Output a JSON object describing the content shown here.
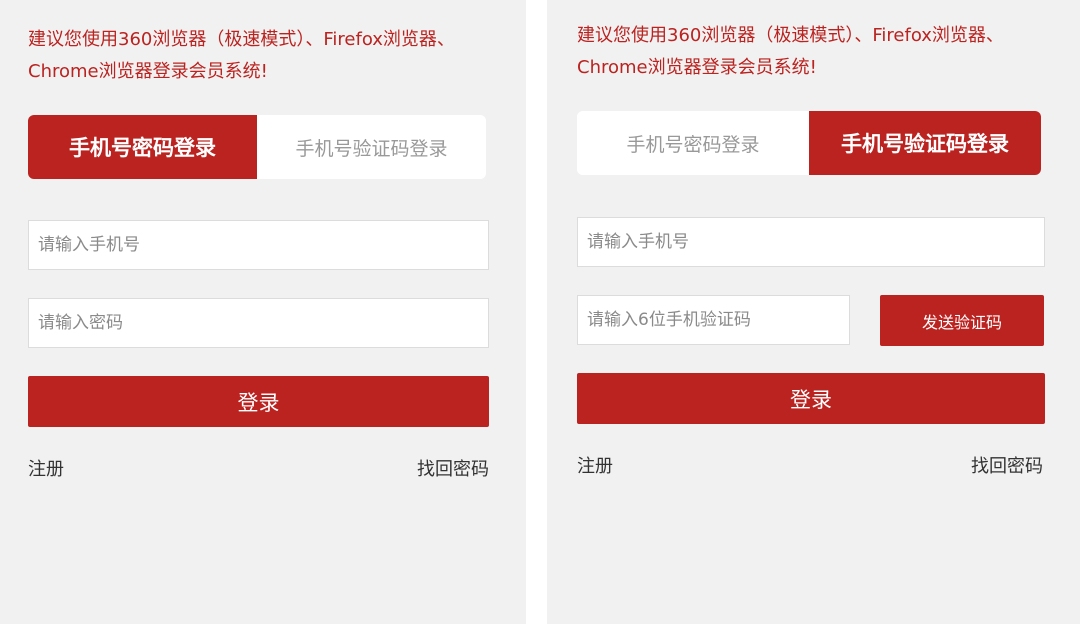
{
  "colors": {
    "brand_red": "#bb2320",
    "panel_bg": "#f1f1f1",
    "inactive_tab_text": "#999999"
  },
  "left_panel": {
    "notice": "建议您使用360浏览器（极速模式）、Firefox浏览器、Chrome浏览器登录会员系统!",
    "tabs": [
      {
        "label": "手机号密码登录",
        "active": true
      },
      {
        "label": "手机号验证码登录",
        "active": false
      }
    ],
    "phone_placeholder": "请输入手机号",
    "password_placeholder": "请输入密码",
    "login_label": "登录",
    "register_label": "注册",
    "forgot_label": "找回密码"
  },
  "right_panel": {
    "notice": "建议您使用360浏览器（极速模式）、Firefox浏览器、Chrome浏览器登录会员系统!",
    "tabs": [
      {
        "label": "手机号密码登录",
        "active": false
      },
      {
        "label": "手机号验证码登录",
        "active": true
      }
    ],
    "phone_placeholder": "请输入手机号",
    "code_placeholder": "请输入6位手机验证码",
    "send_code_label": "发送验证码",
    "login_label": "登录",
    "register_label": "注册",
    "forgot_label": "找回密码"
  }
}
